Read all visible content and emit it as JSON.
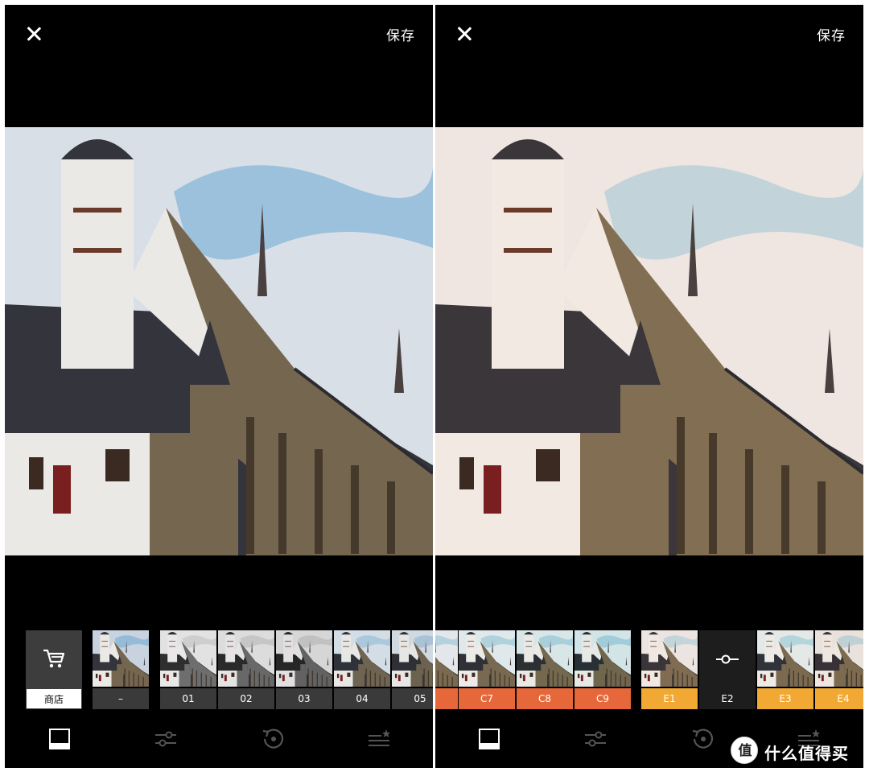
{
  "left_panel": {
    "save_label": "保存",
    "filters": [
      {
        "label": "商店",
        "kind": "shop"
      },
      {
        "label": "–",
        "kind": "original"
      },
      {
        "label": "01",
        "kind": "bw"
      },
      {
        "label": "02",
        "kind": "bw"
      },
      {
        "label": "03",
        "kind": "bw"
      },
      {
        "label": "04",
        "kind": "color"
      },
      {
        "label": "05",
        "kind": "color"
      }
    ]
  },
  "right_panel": {
    "save_label": "保存",
    "filters": [
      {
        "label": "",
        "kind": "partial-orange"
      },
      {
        "label": "C7",
        "kind": "orange"
      },
      {
        "label": "C8",
        "kind": "orange"
      },
      {
        "label": "C9",
        "kind": "orange"
      },
      {
        "label": "E1",
        "kind": "yellow"
      },
      {
        "label": "E2",
        "kind": "selected"
      },
      {
        "label": "E3",
        "kind": "yellow"
      },
      {
        "label": "E4",
        "kind": "yellow"
      }
    ]
  },
  "toolbar_icons": [
    "frame-icon",
    "sliders-icon",
    "history-icon",
    "recipes-icon"
  ],
  "watermark": {
    "badge": "值",
    "text": "什么值得买"
  },
  "colors": {
    "panel_bg": "#000000",
    "orange_label": "#e6683a",
    "yellow_label": "#f1a934",
    "gray_label": "#3a3a3a",
    "selected_bg": "#1d1d1d"
  }
}
